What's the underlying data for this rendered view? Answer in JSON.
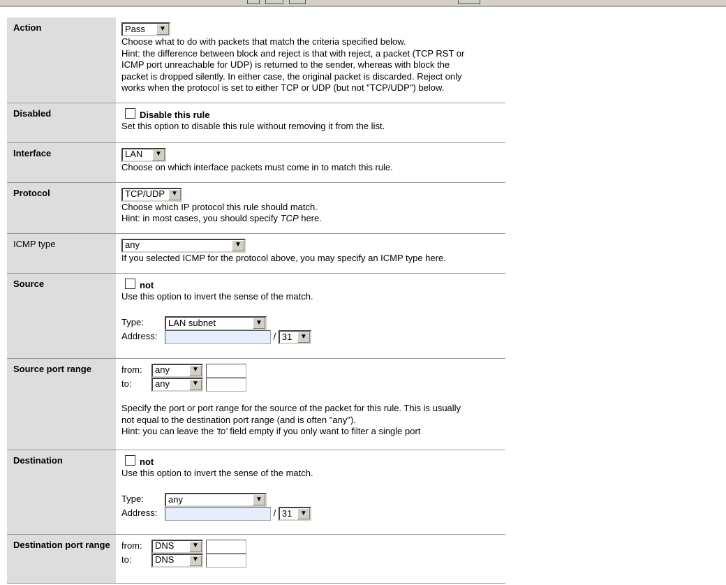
{
  "action": {
    "label": "Action",
    "value": "Pass",
    "desc": [
      "Choose what to do with packets that match the criteria specified below.",
      "Hint: the difference between block and reject is that with reject, a packet (TCP RST or",
      "ICMP port unreachable for UDP) is returned to the sender, whereas with block the",
      "packet is dropped silently. In either case, the original packet is discarded. Reject only",
      "works when the protocol is set to either TCP or UDP (but not \"TCP/UDP\") below."
    ]
  },
  "disabled": {
    "label": "Disabled",
    "checkbox": "Disable this rule",
    "desc": "Set this option to disable this rule without removing it from the list."
  },
  "interface": {
    "label": "Interface",
    "value": "LAN",
    "desc": "Choose on which interface packets must come in to match this rule."
  },
  "protocol": {
    "label": "Protocol",
    "value": "TCP/UDP",
    "desc": "Choose which IP protocol this rule should match.",
    "hint_pre": "Hint: in most cases, you should specify ",
    "hint_em": "TCP",
    "hint_post": "  here."
  },
  "icmp": {
    "label": "ICMP type",
    "value": "any",
    "desc": "If you selected ICMP for the protocol above, you may specify an ICMP type here."
  },
  "source": {
    "label": "Source",
    "not": "not",
    "desc": "Use this option to invert the sense of the match.",
    "type_label": "Type:",
    "type": "LAN subnet",
    "address_label": "Address:",
    "address": "",
    "slash": "/",
    "mask": "31"
  },
  "source_port": {
    "label": "Source port range",
    "from_label": "from:",
    "from": "any",
    "to_label": "to:",
    "to": "any",
    "desc1": "Specify the port or port range for the source of the packet for this rule. This is usually",
    "desc2": "not equal to the destination port range (and is often \"any\").",
    "hint_pre": "Hint: you can leave the ",
    "hint_em": "'to'",
    "hint_post": " field empty if you only want to filter a single port"
  },
  "destination": {
    "label": "Destination",
    "not": "not",
    "desc": "Use this option to invert the sense of the match.",
    "type_label": "Type:",
    "type": "any",
    "address_label": "Address:",
    "address": "",
    "slash": "/",
    "mask": "31"
  },
  "dest_port": {
    "label": "Destination port range",
    "from_label": "from:",
    "from": "DNS",
    "to_label": "to:",
    "to": "DNS"
  }
}
